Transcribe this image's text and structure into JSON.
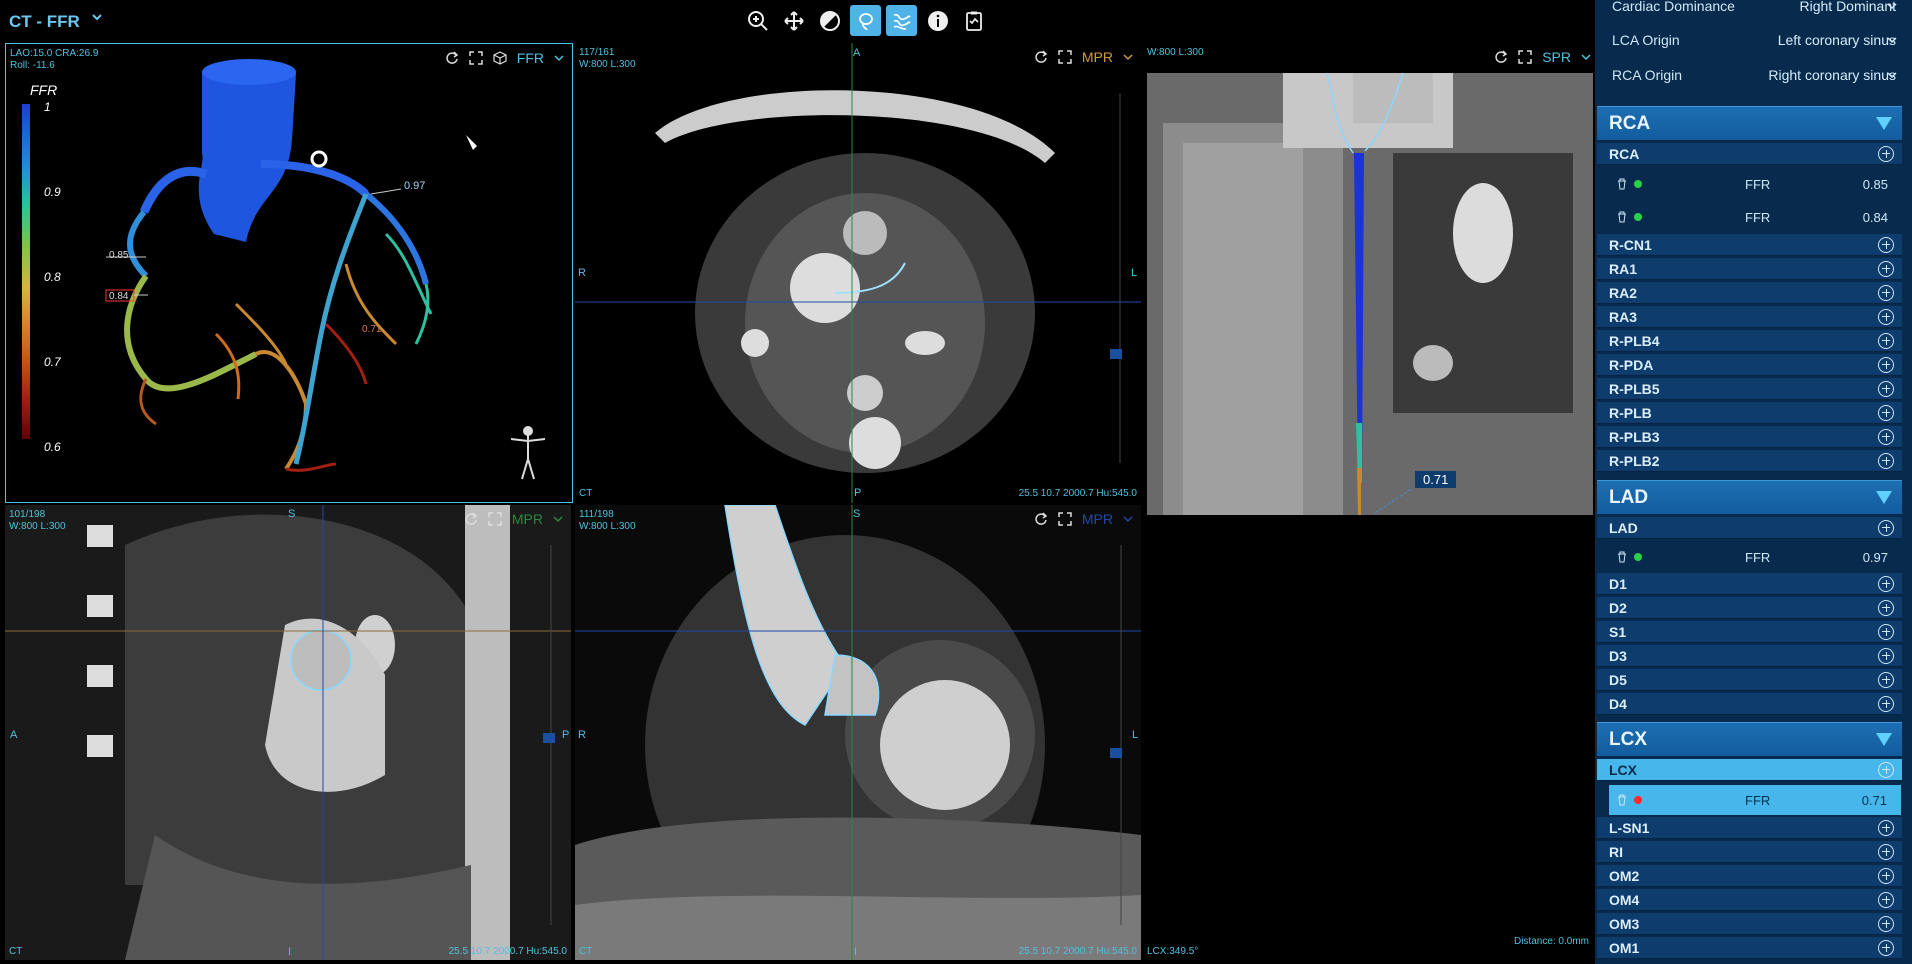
{
  "app": {
    "title": "CT - FFR"
  },
  "toolbar": {
    "tools": [
      "zoom-icon",
      "pan-icon",
      "window-level-icon",
      "lasso-icon",
      "vessel-icon",
      "info-icon",
      "report-icon"
    ]
  },
  "viewer3d": {
    "info_line1": "LAO:15.0   CRA:26.9",
    "info_line2": "Roll: -11.6",
    "mode": "FFR",
    "legend_title": "FFR",
    "legend_ticks": [
      "1",
      "0.9",
      "0.8",
      "0.7",
      "0.6"
    ],
    "labels": {
      "a": "0.97",
      "b": "0.85",
      "c": "0.84",
      "d": "0.71"
    }
  },
  "axial": {
    "info_line1": "117/161",
    "info_line2": "W:800  L:300",
    "mode": "MPR",
    "orient_top": "A",
    "orient_left": "R",
    "orient_right": "L",
    "orient_bottom": "P",
    "corner_bl": "CT",
    "corner_br": "25.5  10.7  2000.7  Hu:545.0"
  },
  "spr": {
    "info_line1": "W:800  L:300",
    "mode": "SPR",
    "value_label": "0.71",
    "distance": "Distance: 0.0mm",
    "angle": "LCX:349.5°"
  },
  "sagittal": {
    "info_line1": "101/198",
    "info_line2": "W:800  L:300",
    "mode": "MPR",
    "orient_top": "S",
    "orient_left": "A",
    "orient_right": "P",
    "orient_bottom": "I",
    "corner_bl": "CT",
    "corner_br": "25.5  10.7  2000.7  Hu:545.0"
  },
  "coronal": {
    "info_line1": "111/198",
    "info_line2": "W:800  L:300",
    "mode": "MPR",
    "orient_top": "S",
    "orient_left": "R",
    "orient_right": "L",
    "orient_bottom": "I",
    "corner_bl": "CT",
    "corner_br": "25.5  10.7  2000.7  Hu:545.0"
  },
  "side": {
    "settings": [
      {
        "label": "Cardiac Dominance",
        "value": "Right Dominant"
      },
      {
        "label": "LCA Origin",
        "value": "Left coronary sinus"
      },
      {
        "label": "RCA Origin",
        "value": "Right coronary sinus"
      }
    ],
    "rca": {
      "title": "RCA",
      "main": "RCA",
      "measures": [
        {
          "label": "FFR",
          "value": "0.85"
        },
        {
          "label": "FFR",
          "value": "0.84"
        }
      ],
      "branches": [
        "R-CN1",
        "RA1",
        "RA2",
        "RA3",
        "R-PLB4",
        "R-PDA",
        "R-PLB5",
        "R-PLB",
        "R-PLB3",
        "R-PLB2"
      ]
    },
    "lad": {
      "title": "LAD",
      "main": "LAD",
      "measures": [
        {
          "label": "FFR",
          "value": "0.97"
        }
      ],
      "branches": [
        "D1",
        "D2",
        "S1",
        "D3",
        "D5",
        "D4"
      ]
    },
    "lcx": {
      "title": "LCX",
      "main": "LCX",
      "measures": [
        {
          "label": "FFR",
          "value": "0.71"
        }
      ],
      "branches": [
        "L-SN1",
        "RI",
        "OM2",
        "OM4",
        "OM3",
        "OM1"
      ]
    },
    "colors": {
      "dot_ok": "#28d34a",
      "dot_bad": "#ff2a2a",
      "accent": "#47b6ea"
    }
  }
}
